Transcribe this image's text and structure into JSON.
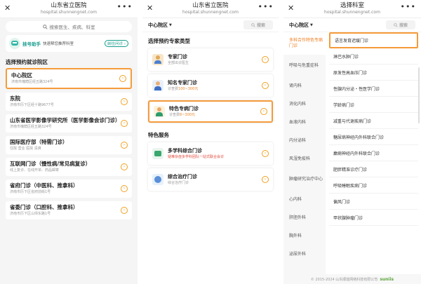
{
  "common": {
    "title": "山东省立医院",
    "subtitle": "hospital.shunnengnet.com",
    "close_glyph": "✕",
    "more_glyph": "•••",
    "chevron_glyph": "›"
  },
  "panel1": {
    "search_placeholder": "搜索医生、疾病、科室",
    "assistant_name": "挂号助手",
    "assistant_desc": "快速帮您推荐科室",
    "assistant_link": "前往问诊 ›",
    "section_title": "选择预约就诊院区",
    "hospitals": [
      {
        "name": "中心院区",
        "address": "济南市槐荫区经五路324号"
      },
      {
        "name": "东院",
        "address": "济南市历下区经十路9677号"
      },
      {
        "name": "山东省医学影像学研究所（医学影像会诊门诊）",
        "address": "济南市槐荫区经五路324号"
      },
      {
        "name": "国际医疗部（特需门诊）",
        "address": "住院  营业  医院  清爽"
      },
      {
        "name": "互联网门诊（慢性病/常见病复诊）",
        "address": "线上复诊、在线开单、药品邮寄"
      },
      {
        "name": "省府门诊（中医科、推拿科）",
        "address": "济南市历下区省府前街1号"
      },
      {
        "name": "省委门诊（口腔科、推拿科）",
        "address": "济南市历下区山师东路1号"
      }
    ]
  },
  "panel2": {
    "campus": "中心院区",
    "campus_caret": "▼",
    "search_label": "搜索",
    "section1": "选择预约专家类型",
    "experts": [
      {
        "title": "专家门诊",
        "sub": "全部出诊医生",
        "fee": ""
      },
      {
        "title": "知名专家门诊",
        "sub": "诊查费",
        "fee": "100~300元"
      },
      {
        "title": "特色专病门诊",
        "sub": "诊查费",
        "fee": "8~300元"
      }
    ],
    "section2": "特色服务",
    "services": [
      {
        "title": "多学科综合门诊",
        "sub": "疑难杂症多学科团队一站式联合会诊"
      },
      {
        "title": "综合治疗门诊",
        "sub": "综合治疗门诊"
      }
    ]
  },
  "panel3": {
    "title": "选择科室",
    "campus": "中心院区",
    "campus_caret": "▼",
    "search_label": "搜索",
    "departments": [
      "多科合作特色专病门诊",
      "呼吸与危重症科",
      "肾内科",
      "消化内科",
      "血液内科",
      "内分泌科",
      "风湿免疫科",
      "肿瘤研究治疗中心",
      "心内科",
      "肝胆外科",
      "胸外科",
      "泌尿外科"
    ],
    "clinics": [
      "语言发育迟缓门诊",
      "淋巴水肿门诊",
      "原发性高血压门诊",
      "性腺内分泌・性医学门诊",
      "学龄病门诊",
      "减重与代谢疾病门诊",
      "糖尿病神经内外科联合门诊",
      "癫痫神经内外科联合门诊",
      "肥胖精准诊疗门诊",
      "呼吸睡眠疾病门诊",
      "偏风门诊",
      "甲状腺肿瘤门诊"
    ],
    "footer_text": "© 2015-2024  山东顺能网络科技有限公司",
    "footer_brand": "suniis"
  },
  "colors": {
    "highlight": "#f59b3a",
    "accent_orange": "#f07c1e",
    "assistant_green": "#159c8b"
  }
}
